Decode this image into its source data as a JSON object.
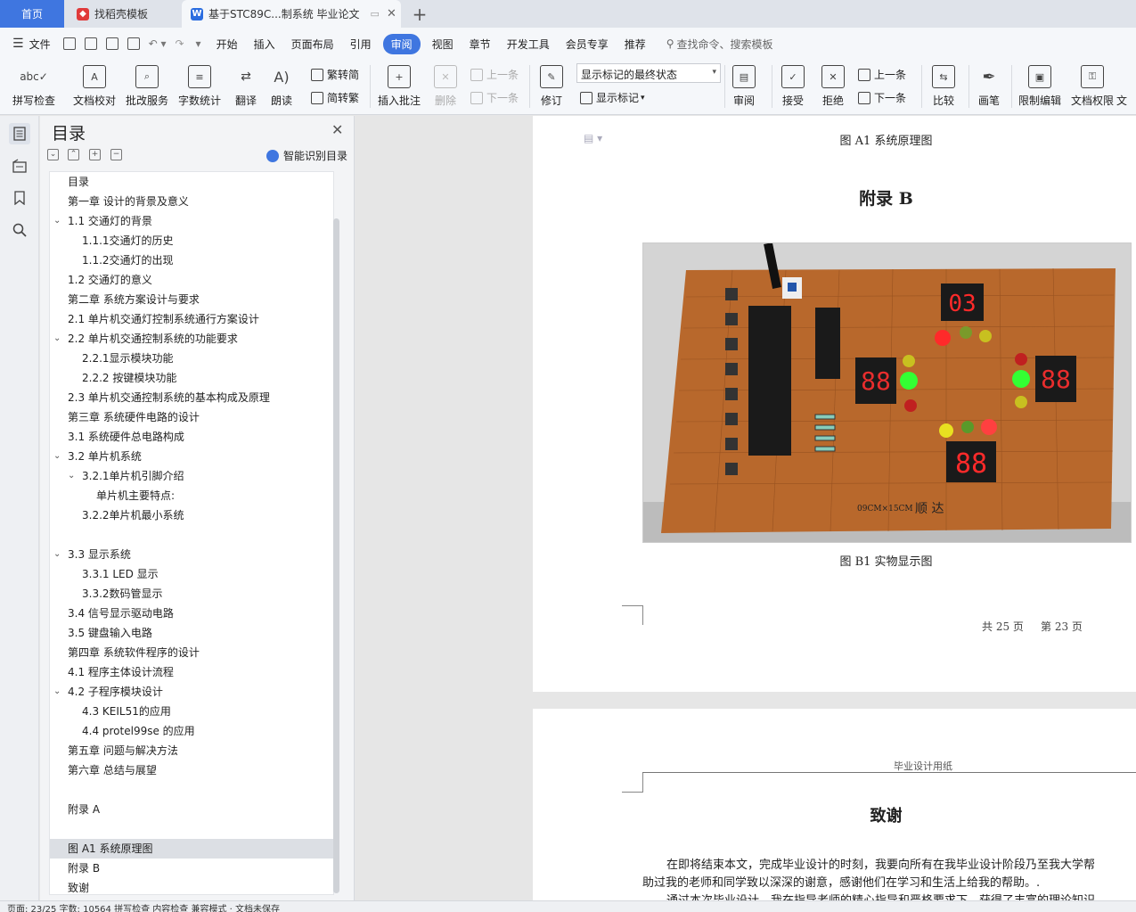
{
  "tabs": {
    "home": "首页",
    "template": "找稻壳模板",
    "doc": "基于STC89C...制系统 毕业论文",
    "add": "+"
  },
  "menu": {
    "file": "文件",
    "items": [
      "开始",
      "插入",
      "页面布局",
      "引用",
      "审阅",
      "视图",
      "章节",
      "开发工具",
      "会员专享",
      "推荐"
    ],
    "active": "审阅",
    "search": "查找命令、搜索模板"
  },
  "ribbon": {
    "spell": "拼写检查",
    "proof": "文档校对",
    "batch": "批改服务",
    "wordcount": "字数统计",
    "translate": "翻译",
    "read": "朗读",
    "trad": "繁转简",
    "simp": "简转繁",
    "insert_comment": "插入批注",
    "delete": "删除",
    "prev": "上一条",
    "next": "下一条",
    "revise": "修订",
    "markup_state": "显示标记的最终状态",
    "show_markup": "显示标记",
    "review": "审阅",
    "accept": "接受",
    "reject": "拒绝",
    "prev2": "上一条",
    "next2": "下一条",
    "compare": "比较",
    "pen": "画笔",
    "restrict": "限制编辑",
    "permission": "文档权限",
    "cut": "文"
  },
  "toc": {
    "title": "目录",
    "smart": "智能识别目录",
    "items": [
      {
        "text": "目录",
        "level": 1,
        "tog": ""
      },
      {
        "text": "第一章  设计的背景及意义",
        "level": 1,
        "tog": ""
      },
      {
        "text": "1.1 交通灯的背景",
        "level": 1,
        "tog": "v"
      },
      {
        "text": "1.1.1交通灯的历史",
        "level": 2,
        "tog": ""
      },
      {
        "text": "1.1.2交通灯的出现",
        "level": 2,
        "tog": ""
      },
      {
        "text": "1.2 交通灯的意义",
        "level": 1,
        "tog": ""
      },
      {
        "text": "第二章    系统方案设计与要求",
        "level": 1,
        "tog": ""
      },
      {
        "text": "2.1 单片机交通灯控制系统通行方案设计",
        "level": 1,
        "tog": ""
      },
      {
        "text": "2.2 单片机交通控制系统的功能要求",
        "level": 1,
        "tog": "v"
      },
      {
        "text": "2.2.1显示模块功能",
        "level": 2,
        "tog": ""
      },
      {
        "text": "2.2.2  按键模块功能",
        "level": 2,
        "tog": ""
      },
      {
        "text": "2.3 单片机交通控制系统的基本构成及原理",
        "level": 1,
        "tog": ""
      },
      {
        "text": "第三章  系统硬件电路的设计",
        "level": 1,
        "tog": ""
      },
      {
        "text": "3.1 系统硬件总电路构成",
        "level": 1,
        "tog": ""
      },
      {
        "text": "3.2 单片机系统",
        "level": 1,
        "tog": "v"
      },
      {
        "text": "3.2.1单片机引脚介绍",
        "level": 2,
        "tog": "v"
      },
      {
        "text": "单片机主要特点:",
        "level": 3,
        "tog": ""
      },
      {
        "text": "3.2.2单片机最小系统",
        "level": 2,
        "tog": ""
      },
      {
        "text": "",
        "level": 1,
        "tog": ""
      },
      {
        "text": "3.3 显示系统",
        "level": 1,
        "tog": "v"
      },
      {
        "text": "3.3.1 LED 显示",
        "level": 2,
        "tog": ""
      },
      {
        "text": "3.3.2数码管显示",
        "level": 2,
        "tog": ""
      },
      {
        "text": "3.4 信号显示驱动电路",
        "level": 1,
        "tog": ""
      },
      {
        "text": "3.5 键盘输入电路",
        "level": 1,
        "tog": ""
      },
      {
        "text": "第四章  系统软件程序的设计",
        "level": 1,
        "tog": ""
      },
      {
        "text": "4.1 程序主体设计流程",
        "level": 1,
        "tog": ""
      },
      {
        "text": "4.2 子程序模块设计",
        "level": 1,
        "tog": "v"
      },
      {
        "text": "4.3  KEIL51的应用",
        "level": 2,
        "tog": ""
      },
      {
        "text": "4.4  protel99se 的应用",
        "level": 2,
        "tog": ""
      },
      {
        "text": "第五章  问题与解决方法",
        "level": 1,
        "tog": ""
      },
      {
        "text": "第六章  总结与展望",
        "level": 1,
        "tog": ""
      },
      {
        "text": "",
        "level": 1,
        "tog": ""
      },
      {
        "text": "附录 A",
        "level": 1,
        "tog": ""
      },
      {
        "text": "",
        "level": 1,
        "tog": ""
      },
      {
        "text": "图 A1  系统原理图",
        "level": 1,
        "tog": "",
        "selected": true
      },
      {
        "text": "附录 B",
        "level": 1,
        "tog": ""
      },
      {
        "text": "致谢",
        "level": 1,
        "tog": ""
      }
    ]
  },
  "page1": {
    "caption_top": "图 A1  系统原理图",
    "heading": "附录 B",
    "board_size": "09CM×15CM",
    "board_brand": "顺    达",
    "display_values": [
      "03",
      "88",
      "88",
      "88"
    ],
    "caption_photo": "图 B1  实物显示图",
    "footer_total": "共 25 页",
    "footer_page": "第 23 页"
  },
  "page2": {
    "header": "毕业设计用纸",
    "heading": "致谢",
    "para1": "在即将结束本文，完成毕业设计的时刻，我要向所有在我毕业设计阶段乃至我大学帮",
    "para2": "助过我的老师和同学致以深深的谢意，感谢他们在学习和生活上给我的帮助。.",
    "para3": "通过本次毕业设计，我在指导老师的精心指导和严格要求下，获得了丰富的理论知识"
  },
  "status": {
    "text": "页面: 23/25    字数: 10564    拼写检查    内容检查    兼容模式    ·    文档未保存"
  },
  "colors": {
    "accent": "#3f76e0",
    "led_red": "#ff2a2a",
    "led_green": "#33ff33",
    "led_yellow": "#e8e020",
    "board": "#b8682c"
  }
}
